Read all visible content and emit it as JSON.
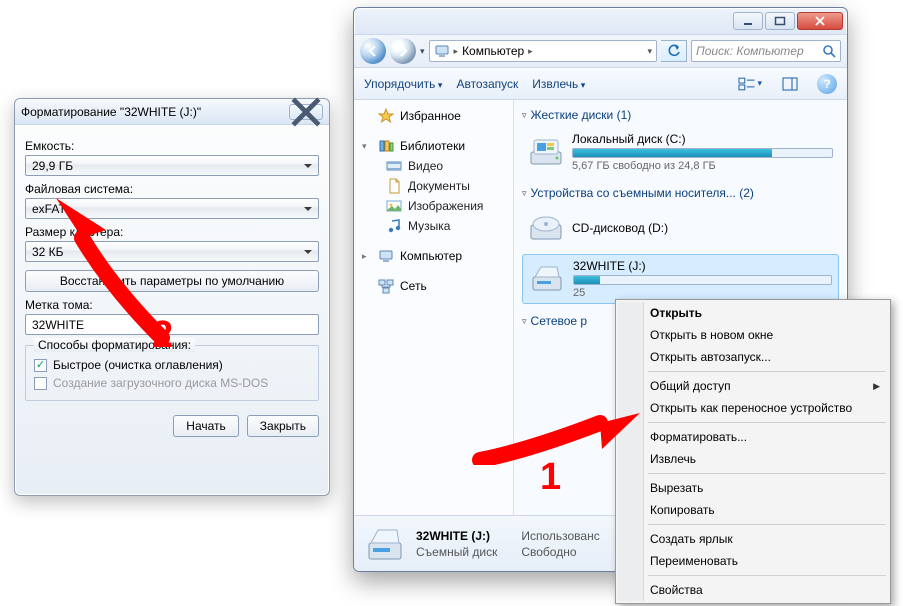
{
  "dialog": {
    "title": "Форматирование \"32WHITE (J:)\"",
    "labels": {
      "capacity": "Емкость:",
      "filesystem": "Файловая система:",
      "cluster": "Размер кластера:",
      "volume": "Метка тома:",
      "methods": "Способы форматирования:"
    },
    "values": {
      "capacity": "29,9 ГБ",
      "filesystem": "exFAT",
      "cluster": "32 КБ",
      "volume": "32WHITE"
    },
    "restore": "Восстановить параметры по умолчанию",
    "quick": "Быстрое (очистка оглавления)",
    "msdos": "Создание загрузочного диска MS-DOS",
    "start": "Начать",
    "close": "Закрыть"
  },
  "explorer": {
    "breadcrumb": {
      "computer": "Компьютер"
    },
    "search_placeholder": "Поиск: Компьютер",
    "toolbar": {
      "organize": "Упорядочить",
      "autoplay": "Автозапуск",
      "eject": "Извлечь"
    },
    "tree": {
      "favorites": "Избранное",
      "libraries": "Библиотеки",
      "video": "Видео",
      "documents": "Документы",
      "images": "Изображения",
      "music": "Музыка",
      "computer": "Компьютер",
      "network": "Сеть"
    },
    "categories": {
      "hdd": "Жесткие диски (1)",
      "removable": "Устройства со съемными носителя... (2)",
      "netloc": "Сетевое р"
    },
    "drives": {
      "c": {
        "name": "Локальный диск (C:)",
        "sub": "5,67 ГБ свободно из 24,8 ГБ",
        "fill_pct": 77
      },
      "d": {
        "name": "CD-дисковод (D:)"
      },
      "j": {
        "name": "32WHITE (J:)",
        "sub": "25"
      }
    },
    "status": {
      "name": "32WHITE (J:)",
      "type": "Съемный диск",
      "used_k": "Использованс",
      "free_k": "Свободно"
    }
  },
  "context": {
    "open": "Открыть",
    "open_new": "Открыть в новом окне",
    "open_auto": "Открыть автозапуск...",
    "share": "Общий доступ",
    "portable": "Открыть как переносное устройство",
    "format": "Форматировать...",
    "eject": "Извлечь",
    "cut": "Вырезать",
    "copy": "Копировать",
    "shortcut": "Создать ярлык",
    "rename": "Переименовать",
    "props": "Свойства"
  },
  "annotations": {
    "one": "1",
    "two": "2"
  }
}
